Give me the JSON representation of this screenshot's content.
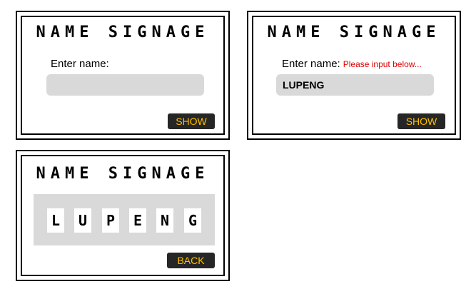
{
  "panels": [
    {
      "title": "NAME SIGNAGE",
      "enter_label": "Enter name:",
      "name_value": "",
      "button_label": "SHOW"
    },
    {
      "title": "NAME SIGNAGE",
      "enter_label": "Enter name:",
      "hint": "Please input below...",
      "name_value": "LUPENG",
      "button_label": "SHOW"
    },
    {
      "title": "NAME SIGNAGE",
      "letters": [
        "L",
        "U",
        "P",
        "E",
        "N",
        "G"
      ],
      "button_label": "BACK"
    }
  ],
  "colors": {
    "button_bg": "#262626",
    "button_text": "#ffc000",
    "field_bg": "#d9d9d9",
    "hint_text": "#e00000"
  }
}
